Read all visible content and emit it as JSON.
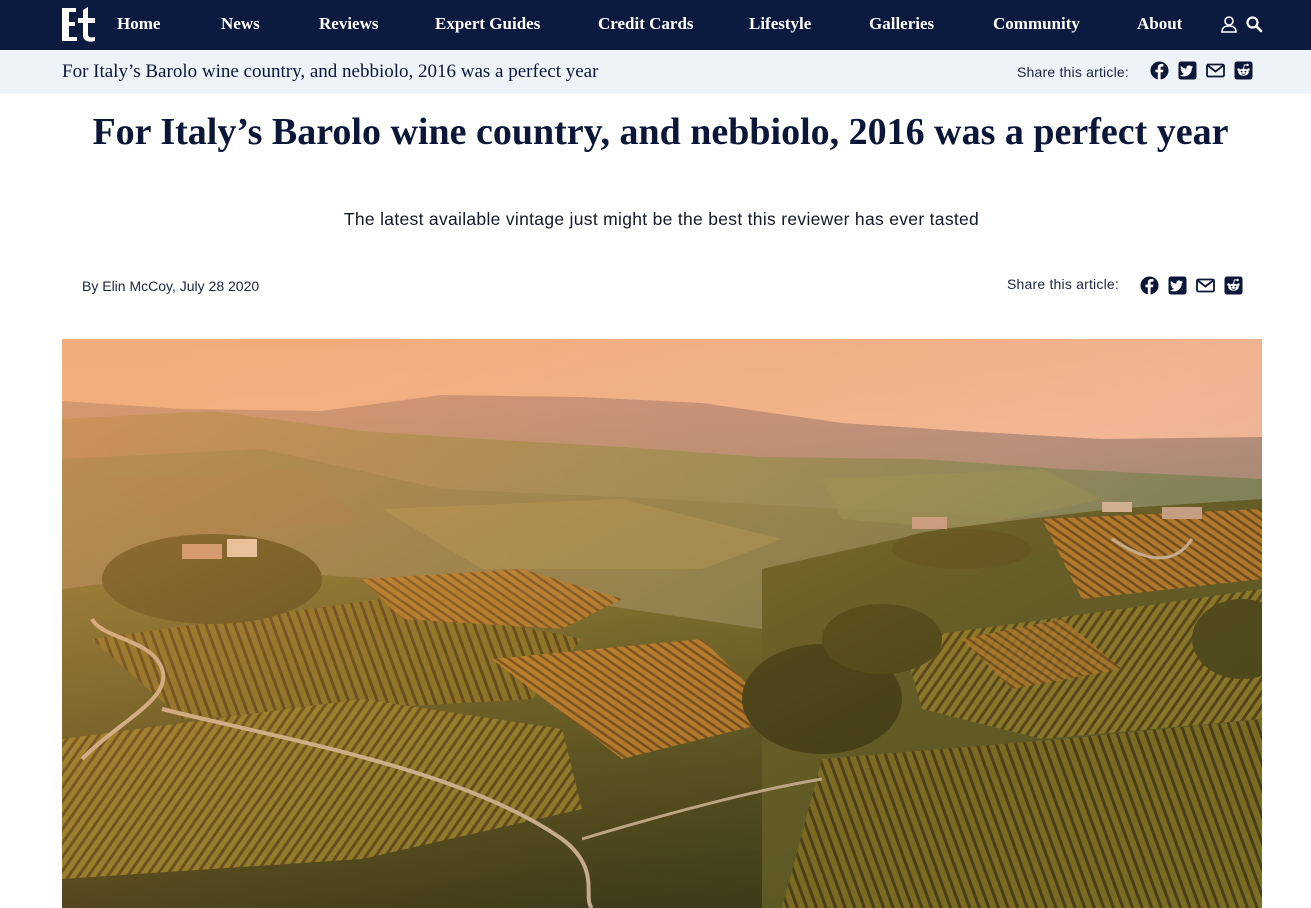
{
  "site": {
    "logo_text": "Et"
  },
  "nav": {
    "items": [
      {
        "label": "Home"
      },
      {
        "label": "News"
      },
      {
        "label": "Reviews"
      },
      {
        "label": "Expert Guides"
      },
      {
        "label": "Credit Cards"
      },
      {
        "label": "Lifestyle"
      },
      {
        "label": "Galleries"
      },
      {
        "label": "Community"
      },
      {
        "label": "About"
      }
    ],
    "icons": [
      "user-icon",
      "search-icon"
    ]
  },
  "sticky_bar": {
    "title": "For Italy’s Barolo wine country, and nebbiolo, 2016 was a perfect year",
    "share_label": "Share this article:",
    "share_icons": [
      "facebook-icon",
      "twitter-icon",
      "email-icon",
      "reddit-icon"
    ]
  },
  "article": {
    "headline": "For Italy’s Barolo wine country, and nebbiolo, 2016 was a perfect year",
    "dek": "The latest available vintage just might be the best this reviewer has ever tasted",
    "byline": "By Elin McCoy, July 28 2020",
    "share_label": "Share this article:",
    "share_icons": [
      "facebook-icon",
      "twitter-icon",
      "email-icon",
      "reddit-icon"
    ],
    "hero_image": "vineyard-hills-photo"
  },
  "colors": {
    "nav_bg": "#0d1a3f",
    "sticky_bg": "#eef3f7",
    "text_dark": "#0b1638"
  }
}
